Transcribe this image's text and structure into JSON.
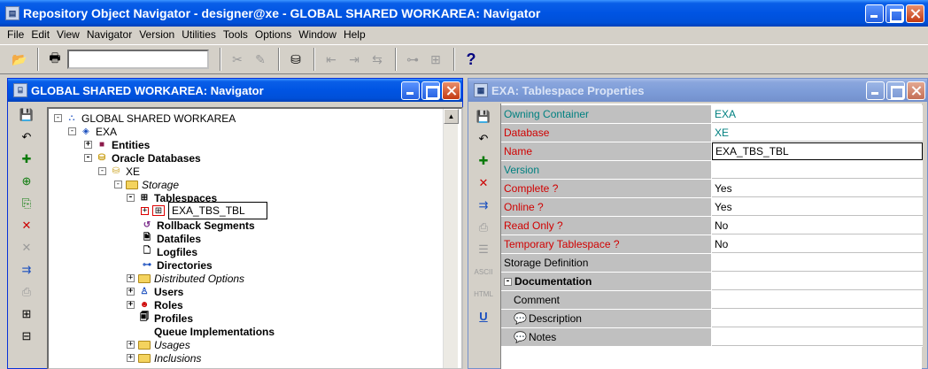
{
  "app": {
    "title": "Repository Object Navigator - designer@xe - GLOBAL SHARED WORKAREA: Navigator"
  },
  "menu": [
    "File",
    "Edit",
    "View",
    "Navigator",
    "Version",
    "Utilities",
    "Tools",
    "Options",
    "Window",
    "Help"
  ],
  "toolbar": {
    "combo_value": "",
    "help_glyph": "?"
  },
  "navigator": {
    "title": "GLOBAL SHARED WORKAREA: Navigator",
    "tree": [
      {
        "label": "GLOBAL SHARED WORKAREA",
        "expander": "-",
        "icon": "workarea-icon",
        "style": ""
      },
      {
        "label": "EXA",
        "expander": "-",
        "icon": "application-icon",
        "style": ""
      },
      {
        "label": "Entities",
        "expander": "+",
        "icon": "entity-icon",
        "style": "bold"
      },
      {
        "label": "Oracle Databases",
        "expander": "-",
        "icon": "database-icon",
        "style": "bold"
      },
      {
        "label": "XE",
        "expander": "-",
        "icon": "database-icon",
        "style": ""
      },
      {
        "label": "Storage",
        "expander": "-",
        "icon": "folder-icon",
        "style": "italic"
      },
      {
        "label": "Tablespaces",
        "expander": "-",
        "icon": "tablespace-icon",
        "style": "bold"
      },
      {
        "label": "EXA_TBS_TBL",
        "expander": "+",
        "icon": "tablespace-icon",
        "style": "edit"
      },
      {
        "label": "Rollback Segments",
        "expander": "",
        "icon": "rollback-icon",
        "style": "bold"
      },
      {
        "label": "Datafiles",
        "expander": "",
        "icon": "datafile-icon",
        "style": "bold"
      },
      {
        "label": "Logfiles",
        "expander": "",
        "icon": "logfile-icon",
        "style": "bold"
      },
      {
        "label": "Directories",
        "expander": "",
        "icon": "directory-icon",
        "style": "bold"
      },
      {
        "label": "Distributed Options",
        "expander": "+",
        "icon": "folder-icon",
        "style": "italic"
      },
      {
        "label": "Users",
        "expander": "+",
        "icon": "user-icon",
        "style": "bold"
      },
      {
        "label": "Roles",
        "expander": "+",
        "icon": "role-icon",
        "style": "bold"
      },
      {
        "label": "Profiles",
        "expander": "",
        "icon": "profile-icon",
        "style": "bold"
      },
      {
        "label": "Queue Implementations",
        "expander": "",
        "icon": "",
        "style": "bold"
      },
      {
        "label": "Usages",
        "expander": "+",
        "icon": "folder-icon",
        "style": "italic"
      },
      {
        "label": "Inclusions",
        "expander": "+",
        "icon": "folder-icon",
        "style": "italic"
      }
    ]
  },
  "properties": {
    "title": "EXA: Tablespace Properties",
    "rows": [
      {
        "name": "Owning Container",
        "value": "EXA",
        "name_color": "teal",
        "value_color": "teal"
      },
      {
        "name": "Database",
        "value": "XE",
        "name_color": "red",
        "value_color": "teal"
      },
      {
        "name": "Name",
        "value": "EXA_TBS_TBL",
        "name_color": "red",
        "value_color": ""
      },
      {
        "name": "Version",
        "value": "",
        "name_color": "teal",
        "value_color": ""
      },
      {
        "name": "Complete ?",
        "value": "Yes",
        "name_color": "red",
        "value_color": ""
      },
      {
        "name": "Online ?",
        "value": "Yes",
        "name_color": "red",
        "value_color": ""
      },
      {
        "name": "Read Only ?",
        "value": "No",
        "name_color": "red",
        "value_color": ""
      },
      {
        "name": "Temporary Tablespace ?",
        "value": "No",
        "name_color": "red",
        "value_color": ""
      },
      {
        "name": "Storage Definition",
        "value": "",
        "name_color": "",
        "value_color": ""
      },
      {
        "name": "Documentation",
        "value": "",
        "name_color": "",
        "value_color": ""
      },
      {
        "name": "Comment",
        "value": "",
        "name_color": "",
        "value_color": ""
      },
      {
        "name": "Description",
        "value": "",
        "name_color": "",
        "value_color": ""
      },
      {
        "name": "Notes",
        "value": "",
        "name_color": "",
        "value_color": ""
      }
    ]
  },
  "colors": {
    "title_active": "#0054e3",
    "title_inactive": "#7c9bd7",
    "required_label": "#d00000",
    "optional_label": "#008080"
  }
}
